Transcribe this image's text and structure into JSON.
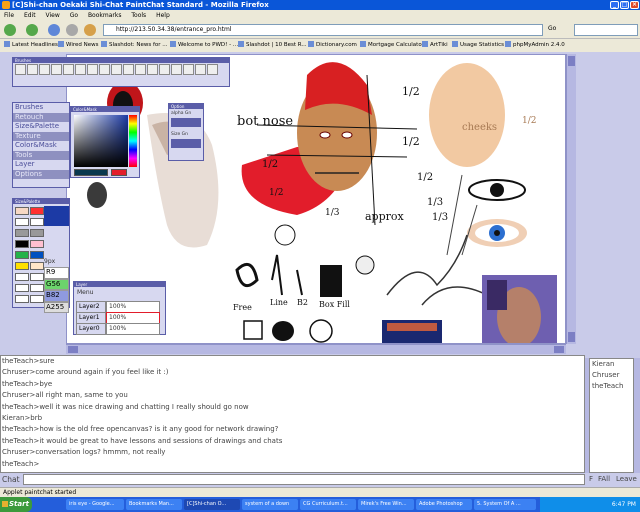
{
  "window": {
    "title": "[C]Shi-chan Oekaki Shi-Chat PaintChat Standard - Mozilla Firefox",
    "min": "_",
    "max": "□",
    "close": "×"
  },
  "menubar": [
    "File",
    "Edit",
    "View",
    "Go",
    "Bookmarks",
    "Tools",
    "Help"
  ],
  "nav": {
    "url": "http://213.50.34.38/entrance_pro.html",
    "go_label": "Go"
  },
  "bookmarks": [
    "Latest Headlines",
    "Wired News",
    "Slashdot: News for ...",
    "Welcome to PWD! - ...",
    "Slashdot | 10 Best R...",
    "Dictionary.com",
    "Mortgage Calculator",
    "ArtTiki",
    "Usage Statistics",
    "phpMyAdmin 2.4.0"
  ],
  "palettes": {
    "brushes_title": "Brushes",
    "colormask_title": "Color&Mask",
    "option_title": "Option",
    "option_labels": [
      "alpha Gn",
      "Size Gn"
    ],
    "sizepalette_title": "Size&Palette",
    "layer_title": "Layer",
    "layer_menu": "Menu",
    "layers": [
      {
        "name": "Layer2",
        "opacity": "100%"
      },
      {
        "name": "Layer1",
        "opacity": "100%"
      },
      {
        "name": "Layer0",
        "opacity": "100%"
      }
    ],
    "menu_items": [
      "Brushes",
      "Retouch",
      "Size&Palette",
      "Texture",
      "Color&Mask",
      "Tools",
      "Layer",
      "Options"
    ],
    "size_label": "9px",
    "rgba": [
      {
        "label": "R",
        "value": "9"
      },
      {
        "label": "G",
        "value": "56"
      },
      {
        "label": "B",
        "value": "82"
      },
      {
        "label": "A",
        "value": "255"
      }
    ],
    "swatch_colors": [
      "#ff0000",
      "#000000",
      "#ffffff",
      "#c0c0c0",
      "#808080",
      "#00ff00",
      "#0000ff",
      "#ffff00",
      "#ff00ff",
      "#00ffff",
      "#ffc0a0",
      "#ffffff"
    ]
  },
  "canvas_annotations": [
    "bot nose",
    "1/2",
    "1/2",
    "1/3",
    "1/2",
    "1/2",
    "1/3",
    "approx",
    "1/2",
    "1/3",
    "Free",
    "Line",
    "B2",
    "Box Fill",
    "cheeks",
    "1/2"
  ],
  "chat": {
    "messages": [
      "theTeach>sure",
      "Chruser>come around again if you feel like it :)",
      "theTeach>bye",
      "Chruser>all right man, same to you",
      "theTeach>well it was nice drawing and chatting I really should go now",
      "Kieran>brb",
      "theTeach>how is the old free opencanvas? is it any good for network drawing?",
      "theTeach>it would be great to have lessons and sessions of drawings and chats",
      "Chruser>conversation logs? hmmm, not really",
      "theTeach>"
    ],
    "users": [
      "Kieran",
      "Chruser",
      "theTeach"
    ],
    "input_label": "Chat",
    "buttons": [
      "F",
      "FAll",
      "Leave"
    ]
  },
  "status": "Applet paintchat started",
  "taskbar": {
    "start_label": "Start",
    "tasks": [
      "iris eye - Google...",
      "Bookmarks Man...",
      "[C]Shi-chan O...",
      "system of a down",
      "CG Curriculum.t...",
      "Mirek's Free Win...",
      "Adobe Photoshop",
      "5. System Of A ..."
    ],
    "time": "6:47 PM"
  }
}
